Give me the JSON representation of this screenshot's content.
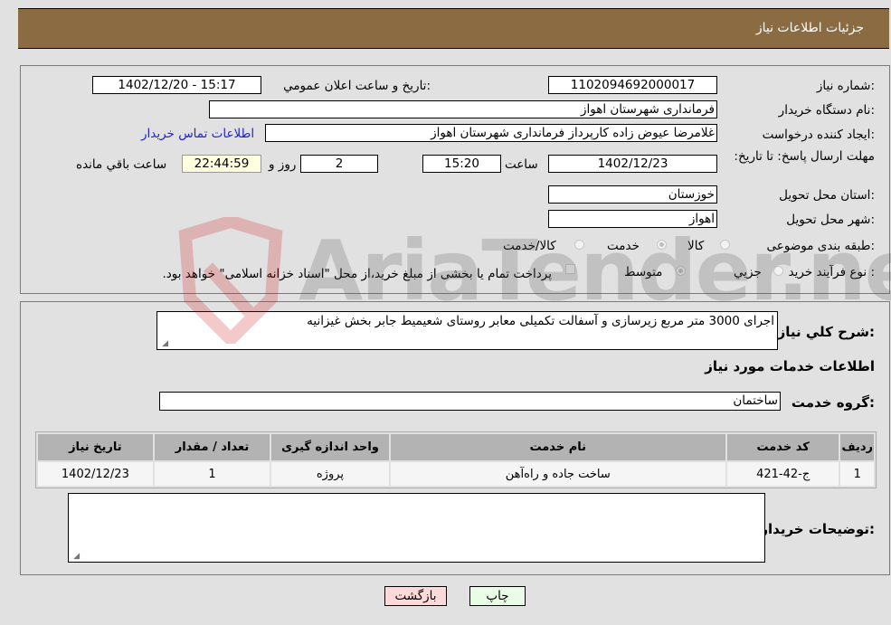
{
  "header": {
    "title": "جزئیات اطلاعات نیاز"
  },
  "form": {
    "need_number": {
      "label": "شماره نیاز:",
      "value": "1102094692000017"
    },
    "announce_datetime": {
      "label": "تاریخ و ساعت اعلان عمومي:",
      "value": "1402/12/20 - 15:17"
    },
    "buyer_org": {
      "label": "نام دستگاه خریدار:",
      "value": "فرمانداری شهرستان اهواز"
    },
    "requester": {
      "label": "ایجاد کننده درخواست:",
      "value": "غلامرضا عیوض زاده  کارپرداز فرمانداری شهرستان اهواز"
    },
    "buyer_contact_link": "اطلاعات تماس خریدار",
    "deadline": {
      "label": "مهلت ارسال پاسخ: تا تاریخ:",
      "date": "1402/12/23",
      "time_label": "ساعت",
      "time": "15:20",
      "days": "2",
      "days_label": "روز و",
      "remaining": "22:44:59",
      "remaining_label": "ساعت باقي مانده"
    },
    "province": {
      "label": "استان محل تحویل:",
      "value": "خوزستان"
    },
    "city": {
      "label": "شهر محل تحویل:",
      "value": "اهواز"
    },
    "category": {
      "label": "طبقه بندی موضوعی:",
      "options": [
        "کالا",
        "خدمت",
        "کالا/خدمت"
      ],
      "selected": "خدمت"
    },
    "purchase_type": {
      "label": "نوع فرآیند خرید :",
      "options": [
        "جزيي",
        "متوسط"
      ],
      "selected": "متوسط",
      "treasury_note": "پرداخت تمام یا بخشی از مبلغ خرید،از محل \"اسناد خزانه اسلامی\" خواهد بود."
    }
  },
  "details": {
    "description_label": "شرح کلي نياز:",
    "description": "اجرای 3000 متر مربع زیرسازی و آسفالت تکمیلی معابر روستای شعیمیط جابر بخش غیزانیه",
    "services_heading": "اطلاعات خدمات مورد نیاز",
    "service_group_label": "گروه خدمت:",
    "service_group": "ساختمان",
    "table": {
      "headers": [
        "ردیف",
        "کد خدمت",
        "نام خدمت",
        "واحد اندازه گیری",
        "تعداد / مقدار",
        "تاریخ نیاز"
      ],
      "rows": [
        [
          "1",
          "ج-42-421",
          "ساخت جاده و راه‌آهن",
          "پروژه",
          "1",
          "1402/12/23"
        ]
      ]
    },
    "buyer_notes_label": "توضیحات خریدار:",
    "buyer_notes": ""
  },
  "buttons": {
    "print": "چاپ",
    "back": "بازگشت"
  },
  "watermark": {
    "text": "AriaTender.neT"
  }
}
